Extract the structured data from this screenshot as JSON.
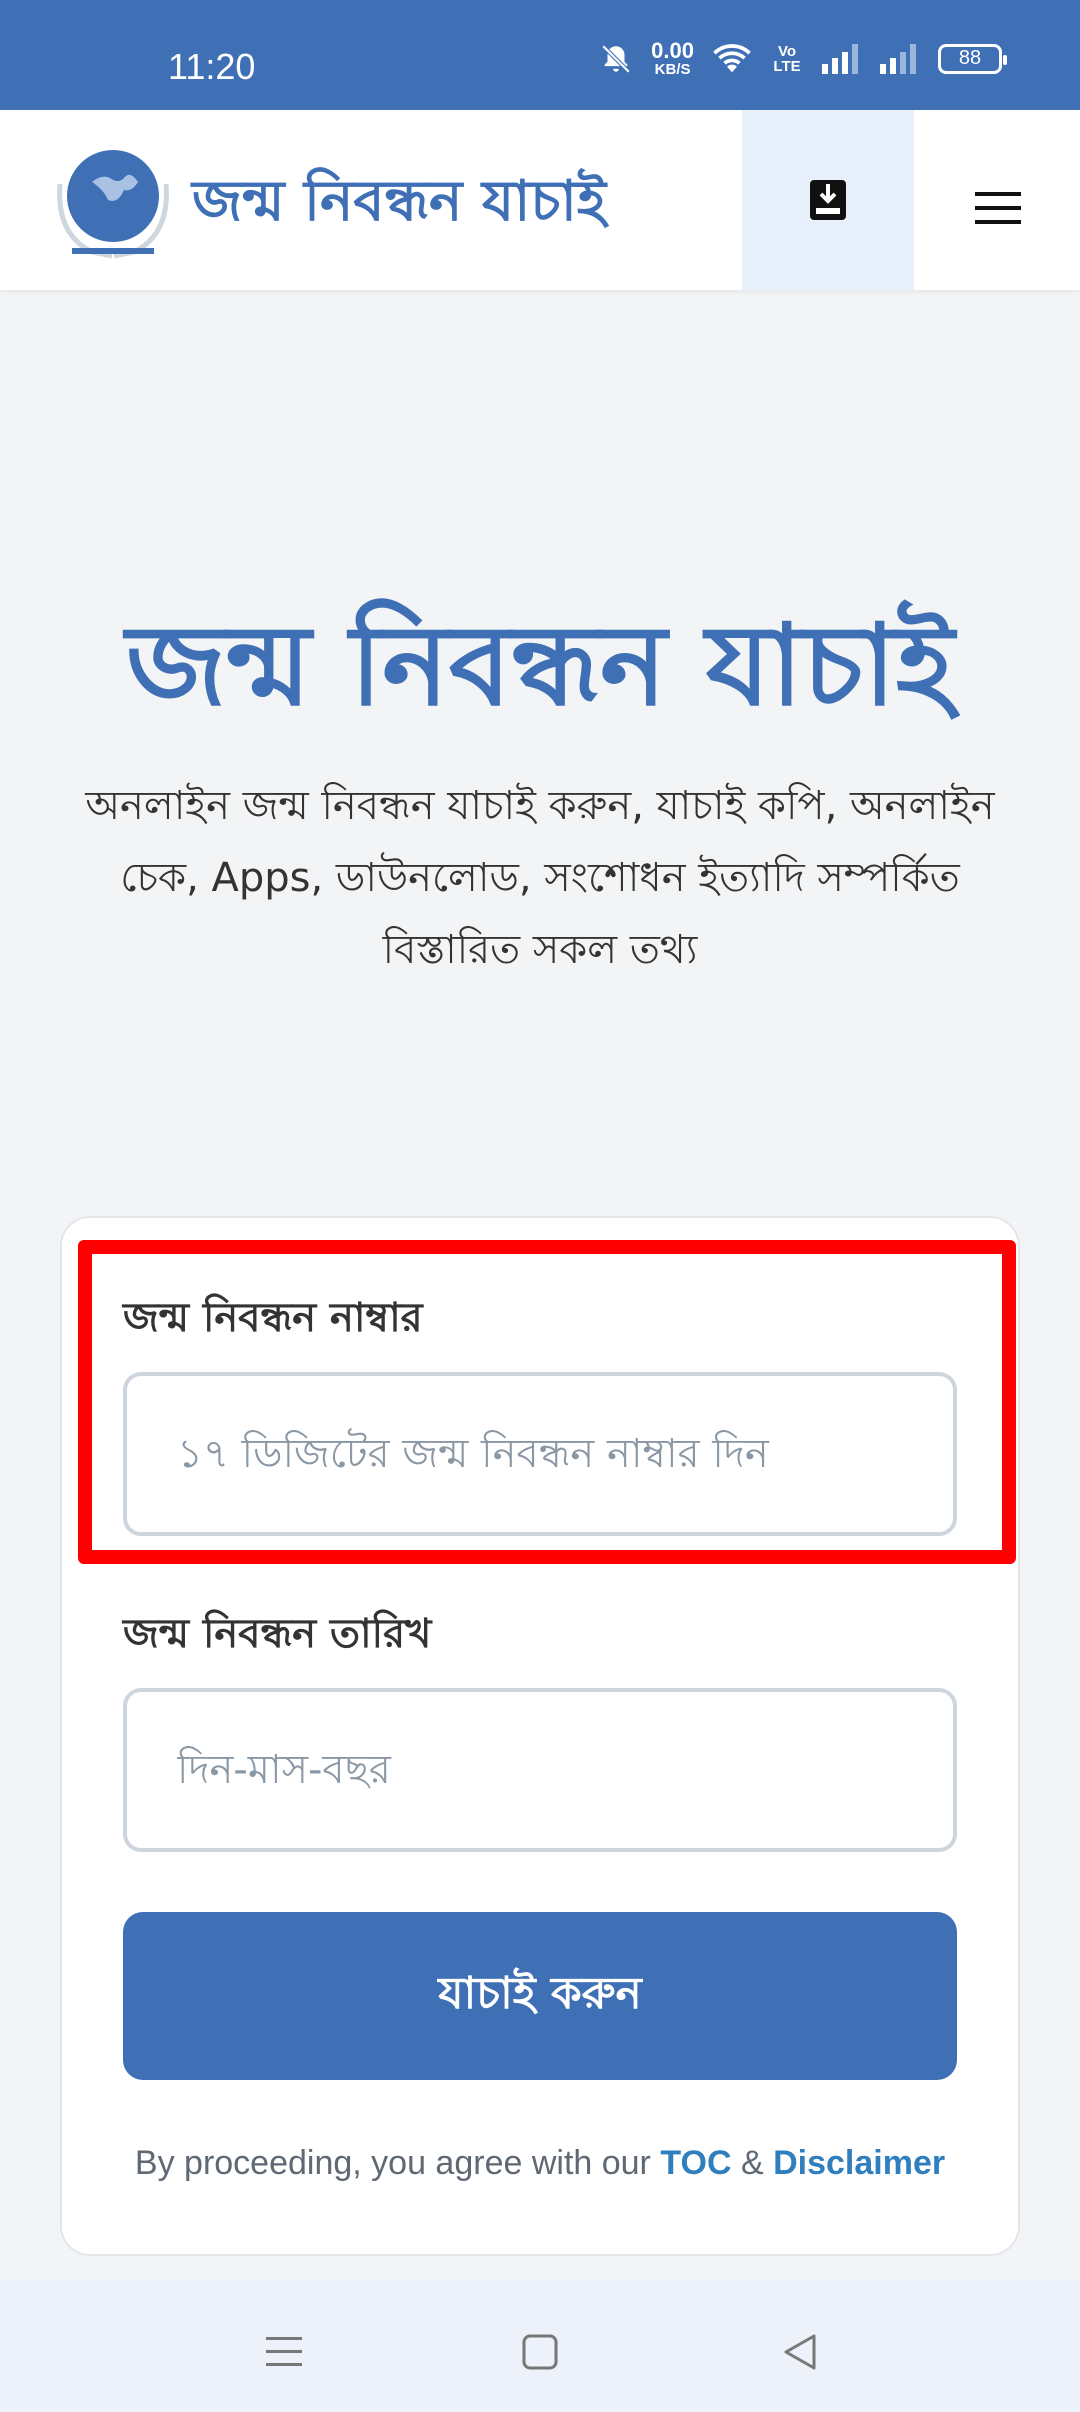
{
  "status_bar": {
    "time": "11:20",
    "net_speed_value": "0.00",
    "net_speed_unit": "KB/S",
    "volte": "Vo LTE",
    "battery": "88"
  },
  "header": {
    "brand": "জন্ম নিবন্ধন যাচাই",
    "logo_icon": "globe-hands-logo",
    "download_icon": "download-icon",
    "menu_icon": "hamburger-menu-icon"
  },
  "hero": {
    "title": "জন্ম নিবন্ধন যাচাই",
    "subtitle": "অনলাইন জন্ম নিবন্ধন যাচাই করুন, যাচাই কপি, অনলাইন চেক, Apps, ডাউনলোড, সংশোধন ইত্যাদি সম্পর্কিত বিস্তারিত সকল তথ্য"
  },
  "form": {
    "reg_number_label": "জন্ম নিবন্ধন নাম্বার",
    "reg_number_placeholder": "১৭ ডিজিটের জন্ম নিবন্ধন নাম্বার দিন",
    "reg_date_label": "জন্ম নিবন্ধন তারিখ",
    "reg_date_placeholder": "দিন-মাস-বছর",
    "submit_label": "যাচাই করুন",
    "terms_prefix": "By proceeding, you agree with our",
    "terms_toc": "TOC",
    "terms_amp": "&",
    "terms_disclaimer": "Disclaimer"
  },
  "colors": {
    "primary": "#3f70b6",
    "highlight": "#ff0000",
    "link": "#2f7fbf"
  }
}
